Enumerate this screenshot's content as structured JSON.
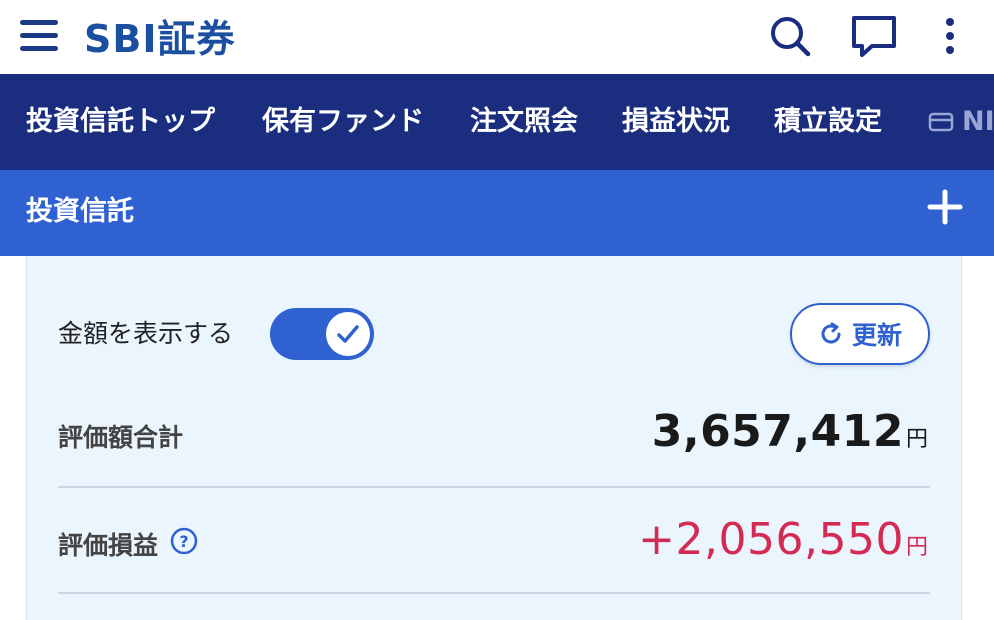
{
  "header": {
    "logo": "SBI証券",
    "icons": [
      "menu-icon",
      "search-icon",
      "chat-icon",
      "more-vertical-icon"
    ]
  },
  "nav": {
    "items": [
      "投資信託トップ",
      "保有ファンド",
      "注文照会",
      "損益状況",
      "積立設定",
      "NIS"
    ]
  },
  "section": {
    "title": "投資信託",
    "expand_icon": "plus-icon"
  },
  "card": {
    "toggle_label": "金額を表示する",
    "toggle_on": true,
    "refresh_label": "更新",
    "rows": [
      {
        "label": "評価額合計",
        "value": "3,657,412",
        "unit": "円",
        "color": "#1a1a1a"
      },
      {
        "label": "評価損益",
        "value": "+2,056,550",
        "unit": "円",
        "color": "#d42b55"
      }
    ]
  },
  "colors": {
    "brand": "#1b4fa0",
    "nav_bg": "#1a2d7e",
    "section_bg": "#2f62d0",
    "card_bg": "#eaf5fd",
    "gain": "#d42b55"
  }
}
